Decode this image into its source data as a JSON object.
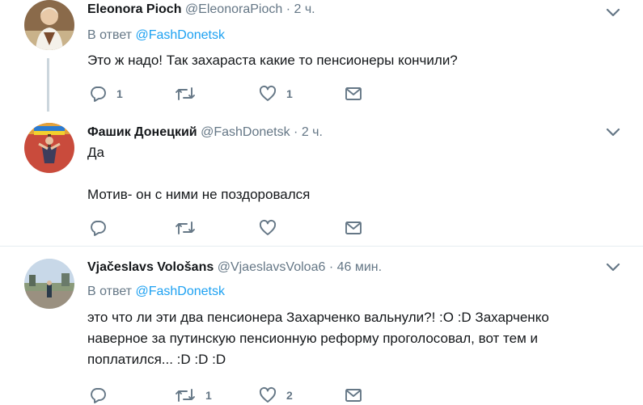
{
  "tweets": [
    {
      "name": "Eleonora Pioch",
      "handle": "@EleonoraPioch",
      "dot": "·",
      "time": "2 ч.",
      "reply_prefix": "В ответ",
      "reply_to": "@FashDonetsk",
      "lines": [
        "Это ж надо! Так захараста какие то пенсионеры кончили?"
      ],
      "reply_count": "1",
      "retweet_count": "",
      "like_count": "1"
    },
    {
      "name": "Фашик Донецкий",
      "handle": "@FashDonetsk",
      "dot": "·",
      "time": "2 ч.",
      "lines": [
        "Да",
        "",
        "Мотив- он с ними не поздоровался"
      ],
      "reply_count": "",
      "retweet_count": "",
      "like_count": ""
    },
    {
      "name": "Vjačeslavs Vološans",
      "handle": "@VjaeslavsVoloa6",
      "dot": "·",
      "time": "46 мин.",
      "reply_prefix": "В ответ",
      "reply_to": "@FashDonetsk",
      "lines": [
        "это что ли эти два пенсионера Захарченко вальнули?! :O :D Захарченко",
        "наверное за путинскую пенсионную реформу проголосовал, вот тем и",
        "поплатился... :D :D :D"
      ],
      "reply_count": "",
      "retweet_count": "1",
      "like_count": "2"
    }
  ],
  "icons": {
    "reply": "reply-icon",
    "retweet": "retweet-icon",
    "like": "heart-icon",
    "dm": "envelope-icon",
    "more": "chevron-down-icon"
  },
  "colors": {
    "name": "#14171a",
    "muted": "#657786",
    "link": "#1da1f2",
    "separator": "#e6ecf0",
    "thread_line": "#ccd6dd"
  }
}
